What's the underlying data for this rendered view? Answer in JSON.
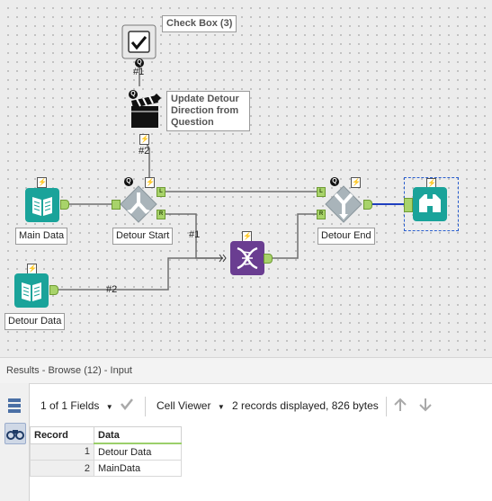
{
  "canvas": {
    "tools": {
      "check_box": {
        "label": "Check Box (3)"
      },
      "action": {
        "annotation": "Update Detour Direction from Question"
      },
      "main_data": {
        "label": "Main Data"
      },
      "detour_start": {
        "label": "Detour Start",
        "anchor_left": "L",
        "anchor_right": "R"
      },
      "detour_end": {
        "label": "Detour End",
        "anchor_left": "L",
        "anchor_right": "R"
      },
      "detour_data": {
        "label": "Detour Data"
      },
      "browse": {
        "label": ""
      },
      "transform": {
        "label": ""
      }
    },
    "connections": {
      "c1": "#1",
      "c2": "#2",
      "c3": "#1",
      "c4": "#2"
    },
    "badges": {
      "question": "Q",
      "bolt": "⚡"
    }
  },
  "results": {
    "title": "Results - Browse (12) - Input",
    "toolbar": {
      "fields": "1 of 1 Fields",
      "viewer": "Cell Viewer",
      "records_info": "2 records displayed, 826 bytes"
    },
    "table": {
      "columns": [
        "Record",
        "Data"
      ],
      "rows": [
        {
          "record": "1",
          "data": "Detour Data"
        },
        {
          "record": "2",
          "data": "MainData"
        }
      ]
    }
  },
  "colors": {
    "teal": "#1aa39a",
    "detour_gray": "#a9b4ba",
    "purple": "#6a3d91",
    "wire": "#6e6e6e",
    "selected_wire": "#1f3fbf"
  }
}
